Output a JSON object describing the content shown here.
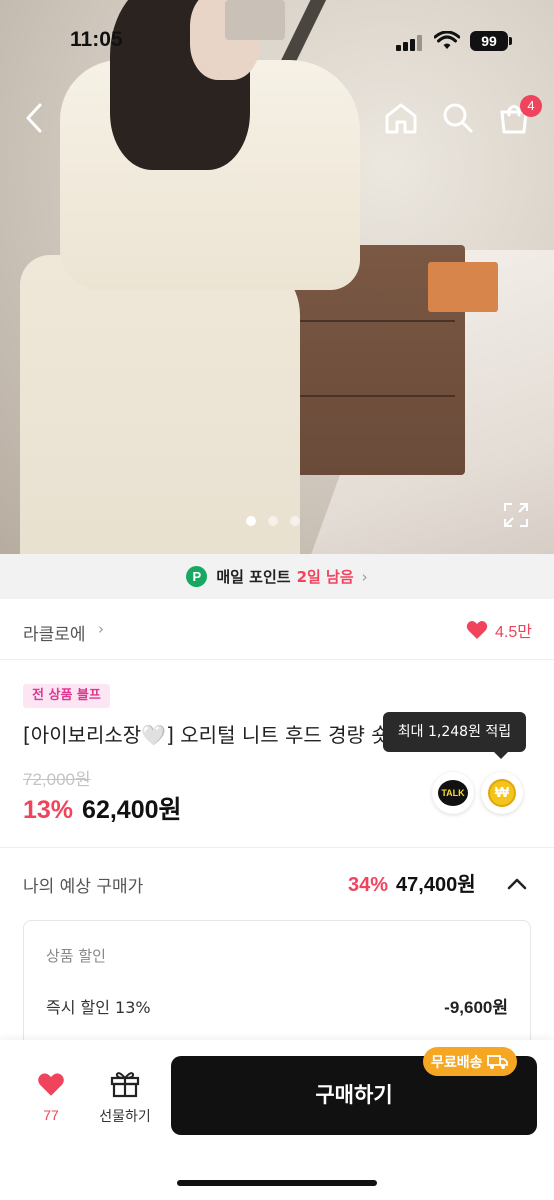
{
  "status_bar": {
    "time": "11:05",
    "battery": "99"
  },
  "header": {
    "cart_count": "4"
  },
  "gallery": {
    "total_slides": 3,
    "active_slide": 1
  },
  "point_banner": {
    "badge": "P",
    "label": "매일 포인트",
    "days_left": "2일 남음"
  },
  "store": {
    "name": "라클로에",
    "likes": "4.5만"
  },
  "product": {
    "tag": "전 상품 블프",
    "title": "[아이보리소장🤍] 오리털 니트 후드 경량 숏 패딩 점퍼",
    "original_price": "72,000원",
    "discount_rate": "13%",
    "price": "62,400원",
    "points_tooltip": "최대 1,248원 적립",
    "talk_label": "TALK",
    "won_symbol": "₩"
  },
  "expected": {
    "label": "나의 예상 구매가",
    "discount_rate": "34%",
    "price": "47,400원",
    "section_title": "상품 할인",
    "row_label": "즉시 할인 13%",
    "row_value": "-9,600원"
  },
  "bottom": {
    "wish_count": "77",
    "gift_label": "선물하기",
    "buy_label": "구매하기",
    "shipping_badge": "무료배송"
  },
  "colors": {
    "accent": "#f0445c",
    "point_green": "#19a862",
    "ship_orange": "#f5a623",
    "tag_pink": "#e0368f"
  }
}
